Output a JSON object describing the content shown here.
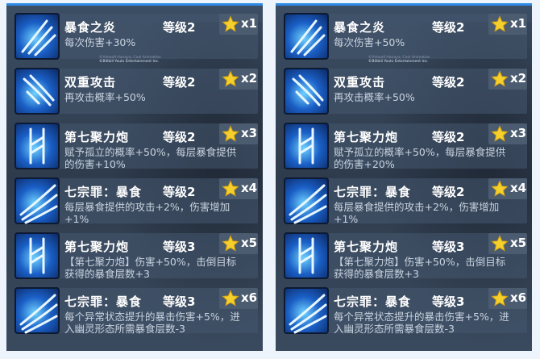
{
  "watermark": [
    "©Arkwall Hanaya, Cool Animation",
    "©Bilibili Youlo Entertainment Inc."
  ],
  "icon_names": [
    "slash-skill-icon",
    "strike-skill-icon",
    "cannon-skill-icon",
    "claw-skill-icon",
    "cannon-skill-icon",
    "claw-skill-icon"
  ],
  "colors": {
    "panel_top_border": "#2f8be6",
    "star": "#f5cf2c",
    "text": "#ffffff",
    "desc": "#c9d3df"
  },
  "left": {
    "skills": [
      {
        "name": "暴食之炎",
        "level": "等级2",
        "count": "x1",
        "desc1": "每次伤害+30%",
        "desc2": ""
      },
      {
        "name": "双重攻击",
        "level": "等级2",
        "count": "x2",
        "desc1": "再攻击概率+50%",
        "desc2": ""
      },
      {
        "name": "第七聚力炮",
        "level": "等级2",
        "count": "x3",
        "desc1": "赋予孤立的概率+50%，每层暴食提供",
        "desc2": "的伤害+10%"
      },
      {
        "name": "七宗罪：暴食",
        "level": "等级2",
        "count": "x4",
        "desc1": "每层暴食提供的攻击+2%，伤害增加",
        "desc2": "+1%"
      },
      {
        "name": "第七聚力炮",
        "level": "等级3",
        "count": "x5",
        "desc1": "【第七聚力炮】伤害+50%，击倒目标",
        "desc2": "获得的暴食层数+3"
      },
      {
        "name": "七宗罪：暴食",
        "level": "等级3",
        "count": "x6",
        "desc1": "每个异常状态提升的暴击伤害+5%，进",
        "desc2": "入幽灵形态所需暴食层数-3"
      }
    ]
  },
  "right": {
    "skills": [
      {
        "name": "暴食之炎",
        "level": "等级2",
        "count": "x1",
        "desc1": "每次伤害+50%",
        "desc2": ""
      },
      {
        "name": "双重攻击",
        "level": "等级2",
        "count": "x2",
        "desc1": "再攻击概率+50%",
        "desc2": ""
      },
      {
        "name": "第七聚力炮",
        "level": "等级2",
        "count": "x3",
        "desc1": "赋予孤立的概率+50%，每层暴食提供",
        "desc2": "的伤害+20%"
      },
      {
        "name": "七宗罪：暴食",
        "level": "等级2",
        "count": "x4",
        "desc1": "每层暴食提供的攻击+2%，伤害增加",
        "desc2": "+1%"
      },
      {
        "name": "第七聚力炮",
        "level": "等级3",
        "count": "x5",
        "desc1": "【第七聚力炮】伤害+50%，击倒目标",
        "desc2": "获得的暴食层数+3"
      },
      {
        "name": "七宗罪：暴食",
        "level": "等级3",
        "count": "x6",
        "desc1": "每个异常状态提升的暴击伤害+5%，进",
        "desc2": "入幽灵形态所需暴食层数-3"
      }
    ]
  }
}
